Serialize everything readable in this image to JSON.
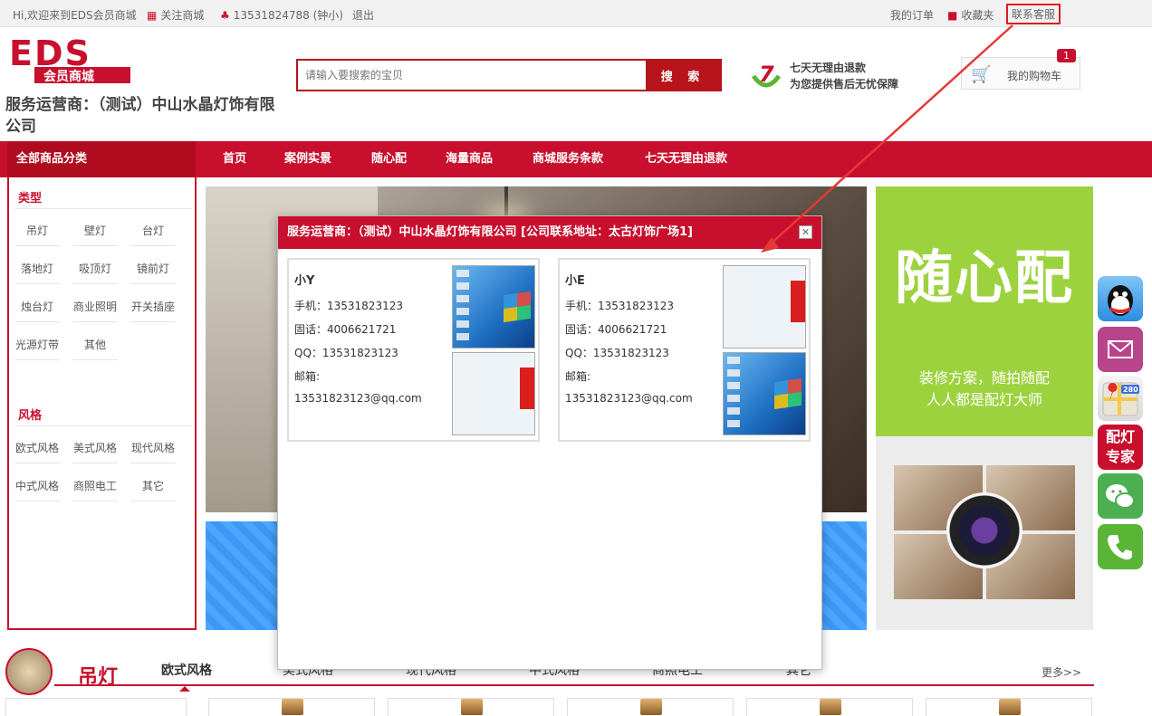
{
  "topbar": {
    "welcome": "Hi,欢迎来到EDS会员商城",
    "follow": "关注商城",
    "phone": "13531824788 (钟小)",
    "logout": "退出",
    "my_orders": "我的订单",
    "favorites": "收藏夹",
    "customer_service": "联系客服"
  },
  "header": {
    "logo_text": "EDS",
    "logo_sub": "会员商城",
    "shop_name": "服务运营商：（测试）中山水晶灯饰有限公司",
    "search_placeholder": "请输入要搜索的宝贝",
    "search_button": "搜 索",
    "guarantee_line1": "七天无理由退款",
    "guarantee_line2": "为您提供售后无忧保障",
    "guarantee_number": "7",
    "cart_label": "我的购物车",
    "cart_count": "1"
  },
  "nav": {
    "all_categories": "全部商品分类",
    "items": [
      "首页",
      "案例实景",
      "随心配",
      "海量商品",
      "商城服务条款",
      "七天无理由退款"
    ]
  },
  "sidebar": {
    "type_title": "类型",
    "types": [
      "吊灯",
      "壁灯",
      "台灯",
      "落地灯",
      "吸顶灯",
      "镜前灯",
      "烛台灯",
      "商业照明",
      "开关插座",
      "光源灯带",
      "其他"
    ],
    "style_title": "风格",
    "styles": [
      "欧式风格",
      "美式风格",
      "现代风格",
      "中式风格",
      "商照电工",
      "其它"
    ]
  },
  "promo": {
    "big_text": "随心配",
    "line1": "装修方案，随拍随配",
    "line2": "人人都是配灯大师"
  },
  "side_buttons": {
    "expert_line1": "配灯",
    "expert_line2": "专家",
    "map_badge": "280"
  },
  "modal": {
    "title": "服务运营商：（测试）中山水晶灯饰有限公司 [公司联系地址：太古灯饰广场1]",
    "contacts": [
      {
        "name": "小Y",
        "mobile": "手机：13531823123",
        "tel": "固话：4006621721",
        "qq": "QQ：13531823123",
        "email_label": "邮箱:",
        "email": "13531823123@qq.com"
      },
      {
        "name": "小E",
        "mobile": "手机：13531823123",
        "tel": "固话：4006621721",
        "qq": "QQ：13531823123",
        "email_label": "邮箱:",
        "email": "13531823123@qq.com"
      }
    ]
  },
  "bottom": {
    "category_title": "吊灯",
    "tabs": [
      "欧式风格",
      "美式风格",
      "现代风格",
      "中式风格",
      "商照电工",
      "其它"
    ],
    "more": "更多>>"
  },
  "colors": {
    "brand_red": "#c8102e",
    "promo_green": "#9dd23f",
    "banner_blue": "#4da6ff"
  }
}
